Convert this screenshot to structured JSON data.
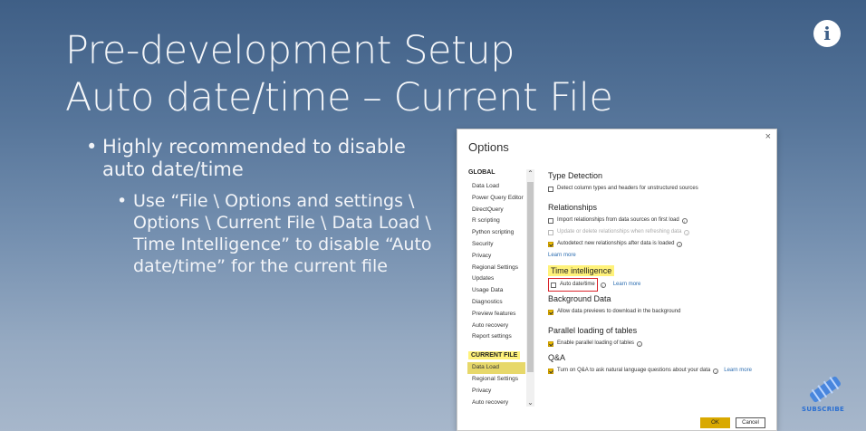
{
  "slide": {
    "title_line1": "Pre-development Setup",
    "title_line2": "Auto date/time – Current File",
    "bullet1": "Highly recommended to disable auto date/time",
    "bullet2": "Use “File \\ Options and settings \\ Options \\ Current File \\ Data Load \\ Time Intelligence” to disable “Auto date/time” for the current file"
  },
  "overlay": {
    "info_glyph": "i",
    "subscribe_label": "SUBSCRIBE"
  },
  "dialog": {
    "title": "Options",
    "close": "×",
    "global_header": "GLOBAL",
    "global_items": [
      "Data Load",
      "Power Query Editor",
      "DirectQuery",
      "R scripting",
      "Python scripting",
      "Security",
      "Privacy",
      "Regional Settings",
      "Updates",
      "Usage Data",
      "Diagnostics",
      "Preview features",
      "Auto recovery",
      "Report settings"
    ],
    "current_header": "CURRENT FILE",
    "current_items": [
      "Data Load",
      "Regional Settings",
      "Privacy",
      "Auto recovery"
    ],
    "type_detection": {
      "heading": "Type Detection",
      "option": "Detect column types and headers for unstructured sources"
    },
    "relationships": {
      "heading": "Relationships",
      "opt1": "Import relationships from data sources on first load",
      "opt2": "Update or delete relationships when refreshing data",
      "opt3": "Autodetect new relationships after data is loaded",
      "learn_more": "Learn more"
    },
    "time_intelligence": {
      "heading": "Time intelligence",
      "option": "Auto date/time",
      "learn_more": "Learn more"
    },
    "background_data": {
      "heading": "Background Data",
      "option": "Allow data previews to download in the background"
    },
    "parallel": {
      "heading": "Parallel loading of tables",
      "option": "Enable parallel loading of tables"
    },
    "qa": {
      "heading": "Q&A",
      "option": "Turn on Q&A to ask natural language questions about your data",
      "learn_more": "Learn more"
    },
    "ok": "OK",
    "cancel": "Cancel"
  }
}
